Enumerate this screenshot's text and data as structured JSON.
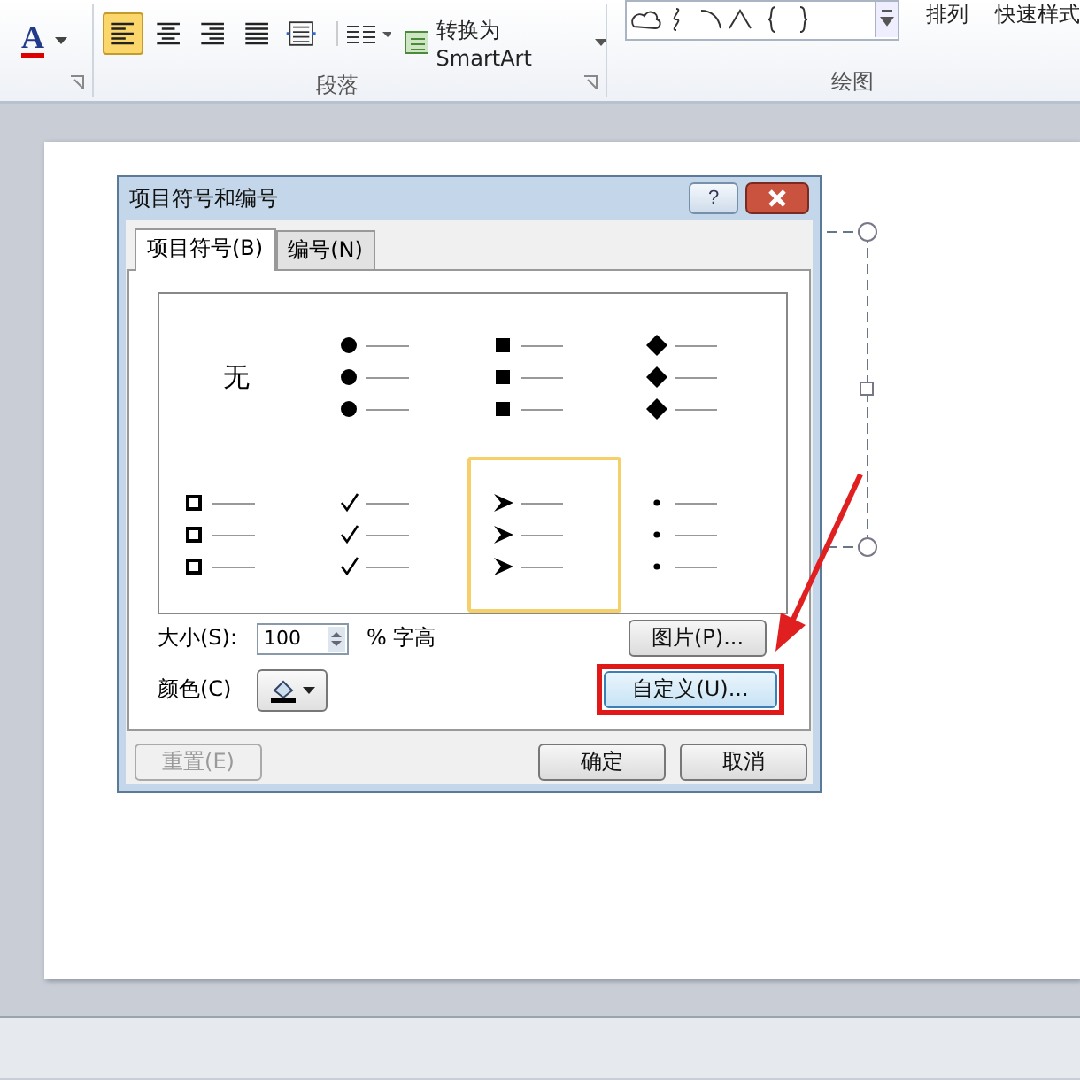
{
  "ribbon": {
    "font_color_letter": "A",
    "paragraph_buttons": [
      {
        "kind": "align-left",
        "selected": true
      },
      {
        "kind": "center",
        "selected": false
      },
      {
        "kind": "align-right",
        "selected": false
      },
      {
        "kind": "justify",
        "selected": false
      },
      {
        "kind": "distributed",
        "selected": false
      }
    ],
    "smartart_button": "转换为 SmartArt",
    "arrange_button": "排列",
    "quick_styles_button": "快速样式",
    "groups": [
      {
        "label": "段落"
      },
      {
        "label": "绘图"
      }
    ]
  },
  "dialog": {
    "title": "项目符号和编号",
    "help": "?",
    "tabs": [
      {
        "label": "项目符号(B)",
        "selected": true
      },
      {
        "label": "编号(N)",
        "selected": false
      }
    ],
    "bullets": [
      {
        "kind": "none",
        "label": "无",
        "selected": false
      },
      {
        "kind": "dot",
        "selected": false
      },
      {
        "kind": "square",
        "selected": false
      },
      {
        "kind": "diamond",
        "selected": false
      },
      {
        "kind": "hollow-square",
        "selected": false
      },
      {
        "kind": "check",
        "selected": false
      },
      {
        "kind": "arrow",
        "selected": true
      },
      {
        "kind": "small-dot",
        "selected": false
      }
    ],
    "size_label": "大小(S):",
    "size_value": "100",
    "size_unit": "% 字高",
    "color_label": "颜色(C)",
    "picture_button": "图片(P)...",
    "custom_button": "自定义(U)...",
    "reset_button": {
      "label": "重置(E)",
      "disabled": true
    },
    "ok_button": "确定",
    "cancel_button": "取消"
  }
}
